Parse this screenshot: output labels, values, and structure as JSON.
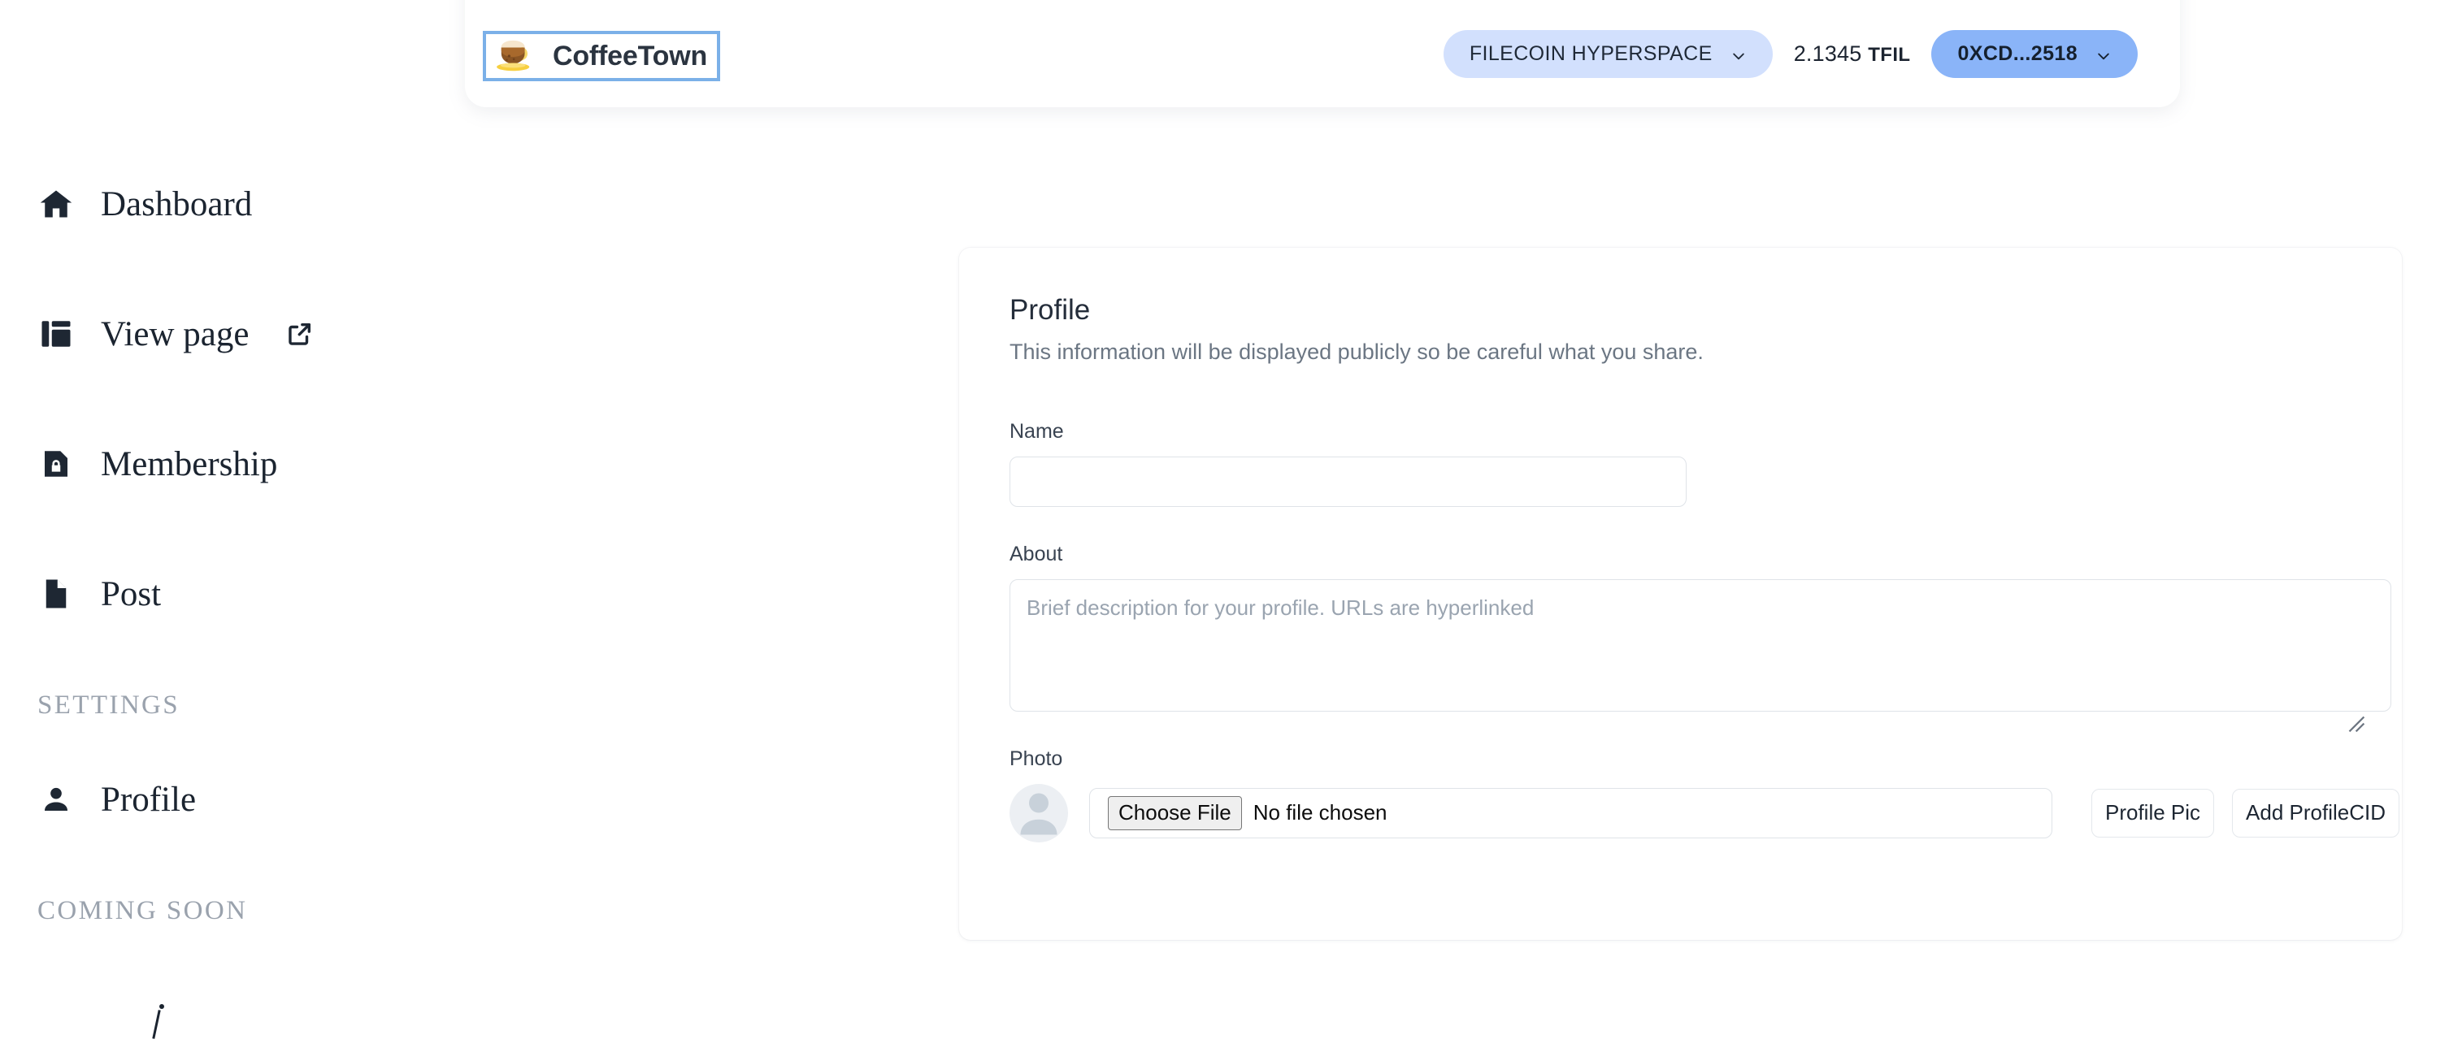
{
  "header": {
    "brand_name": "CoffeeTown",
    "brand_logo_icon": "coffee-cup-icon",
    "network_label": "FILECOIN HYPERSPACE",
    "network_chevron_icon": "chevron-down-icon",
    "balance_amount": "2.1345",
    "balance_unit": "TFIL",
    "wallet_label": "0XCD...2518",
    "wallet_chevron_icon": "chevron-down-icon",
    "colors": {
      "network_pill_bg": "#d2e0fd",
      "wallet_pill_bg": "#8ab4f8",
      "focus_ring": "#7bb0e8"
    }
  },
  "sidebar": {
    "items": [
      {
        "label": "Dashboard",
        "icon": "home-icon",
        "external": false
      },
      {
        "label": "View page",
        "icon": "layout-sidebar-icon",
        "external": true,
        "external_icon": "external-link-icon"
      },
      {
        "label": "Membership",
        "icon": "lock-document-icon",
        "external": false
      },
      {
        "label": "Post",
        "icon": "document-icon",
        "external": false
      }
    ],
    "settings_heading": "SETTINGS",
    "settings_items": [
      {
        "label": "Profile",
        "icon": "person-icon"
      }
    ],
    "coming_soon_heading": "COMING SOON"
  },
  "main": {
    "title": "Profile",
    "subtitle": "This information will be displayed publicly so be careful what you share.",
    "fields": {
      "name": {
        "label": "Name",
        "value": "",
        "placeholder": ""
      },
      "about": {
        "label": "About",
        "value": "",
        "placeholder": "Brief description for your profile. URLs are hyperlinked"
      },
      "photo": {
        "label": "Photo",
        "avatar_icon": "default-avatar-icon",
        "choose_file_label": "Choose File",
        "file_status": "No file chosen",
        "profile_pic_button": "Profile Pic",
        "add_profile_cid_button": "Add ProfileCID"
      }
    }
  }
}
